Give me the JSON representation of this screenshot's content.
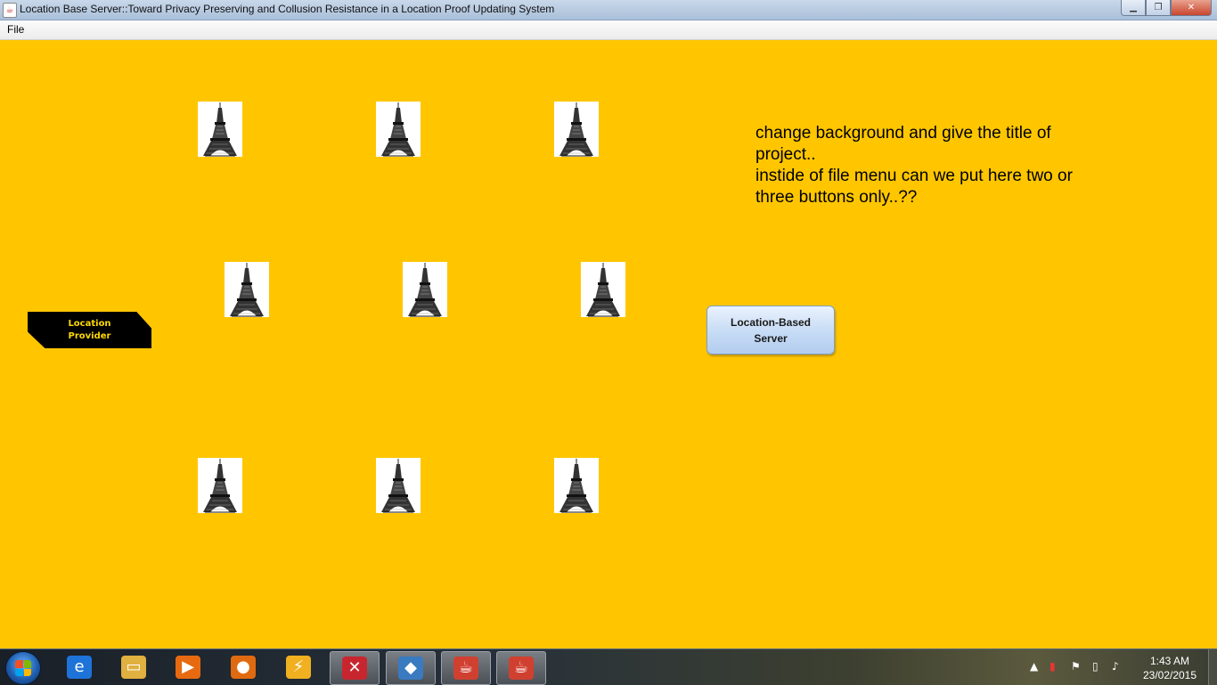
{
  "window": {
    "title": "Location Base Server::Toward Privacy Preserving and Collusion Resistance in a Location Proof Updating System",
    "icon": "java-coffee-icon",
    "controls": [
      "minimize",
      "maximize",
      "close"
    ]
  },
  "menubar": {
    "items": [
      "File"
    ]
  },
  "canvas": {
    "background": "#ffc600",
    "towers": [
      {
        "icon": "eiffel-tower-icon"
      },
      {
        "icon": "eiffel-tower-icon"
      },
      {
        "icon": "eiffel-tower-icon"
      },
      {
        "icon": "eiffel-tower-icon"
      },
      {
        "icon": "eiffel-tower-icon"
      },
      {
        "icon": "eiffel-tower-icon"
      },
      {
        "icon": "eiffel-tower-icon"
      },
      {
        "icon": "eiffel-tower-icon"
      },
      {
        "icon": "eiffel-tower-icon"
      }
    ],
    "note": {
      "lines": [
        "change background and give the title of",
        "project..",
        "instide of file menu can we put  here two or",
        "three buttons only..??"
      ]
    },
    "provider": {
      "line1": "Location",
      "line2": "Provider",
      "color": "#000000",
      "text_color": "#ffd800"
    },
    "server_button": {
      "line1": "Location-Based",
      "line2": "Server"
    }
  },
  "taskbar": {
    "start_icon": "windows-start-icon",
    "items": [
      {
        "name": "internet-explorer-icon",
        "glyph": "e",
        "color": "#1e73d8",
        "active": false
      },
      {
        "name": "folder-icon",
        "glyph": "▭",
        "color": "#e0b040",
        "active": false
      },
      {
        "name": "media-player-icon",
        "glyph": "▶",
        "color": "#e86a10",
        "active": false
      },
      {
        "name": "firefox-icon",
        "glyph": "●",
        "color": "#e06a10",
        "active": false
      },
      {
        "name": "winamp-icon",
        "glyph": "⚡",
        "color": "#f0b020",
        "active": false
      },
      {
        "name": "app-red-icon",
        "glyph": "✕",
        "color": "#c8262e",
        "active": true
      },
      {
        "name": "virtualbox-icon",
        "glyph": "◆",
        "color": "#3a7ac0",
        "active": true
      },
      {
        "name": "java-icon",
        "glyph": "☕",
        "color": "#d04030",
        "active": true
      },
      {
        "name": "java-icon",
        "glyph": "☕",
        "color": "#d04030",
        "active": true
      }
    ],
    "tray": {
      "icons": [
        "show-hidden-icon",
        "network-icon",
        "action-center-icon",
        "power-icon",
        "volume-icon"
      ],
      "time": "1:43 AM",
      "date": "23/02/2015"
    }
  }
}
